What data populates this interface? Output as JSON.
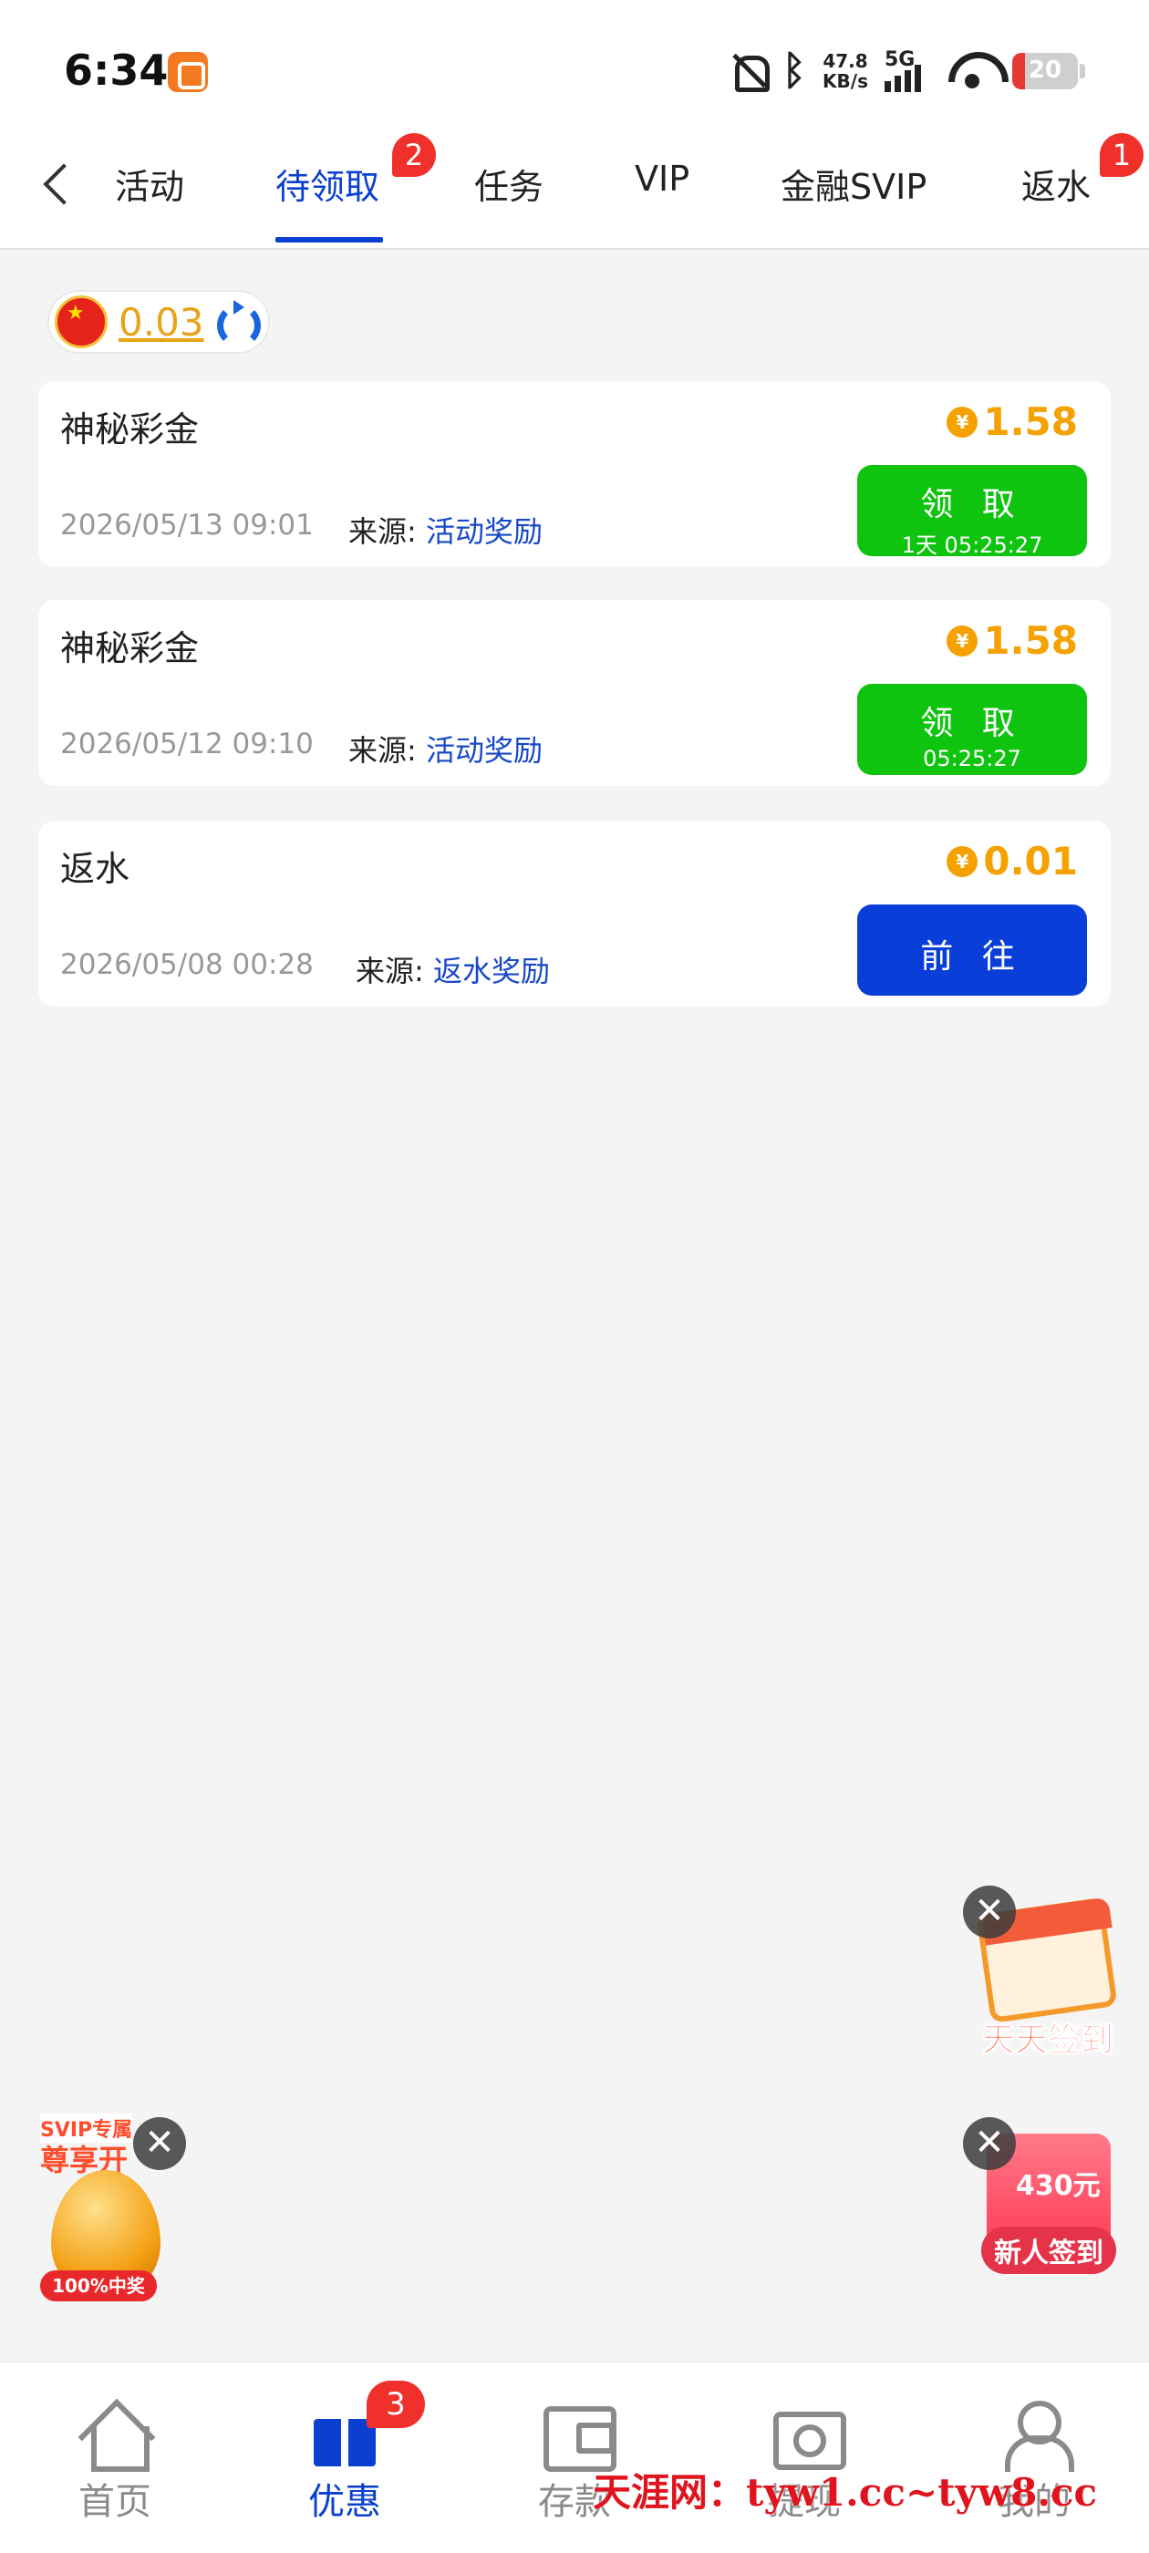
{
  "status_bar": {
    "time": "6:34",
    "net_speed_value": "47.8",
    "net_speed_unit": "KB/s",
    "network_type": "5G",
    "battery": "20",
    "battery_level": 0.2,
    "icons": [
      "app-notification-icon",
      "mute-bell-icon",
      "bluetooth-icon",
      "signal-icon",
      "wifi-icon",
      "battery-icon"
    ]
  },
  "tabs": {
    "items": [
      {
        "label": "活动"
      },
      {
        "label": "待领取",
        "badge": "2",
        "active": true
      },
      {
        "label": "任务"
      },
      {
        "label": "VIP"
      },
      {
        "label": "金融SVIP"
      },
      {
        "label": "返水",
        "badge": "1"
      }
    ],
    "accent_color": "#0a3fd0"
  },
  "balance": {
    "amount": "0.03",
    "flag_icon": "china-flag-icon",
    "refresh_icon": "refresh-icon"
  },
  "rewards": [
    {
      "title": "神秘彩金",
      "amount": "1.58",
      "date": "2026/05/13 09:01",
      "source_label": "来源:",
      "source": "活动奖励",
      "button_label": "领 取",
      "button_sub": "1天 05:25:27",
      "button_color": "#0fc40f"
    },
    {
      "title": "神秘彩金",
      "amount": "1.58",
      "date": "2026/05/12 09:10",
      "source_label": "来源:",
      "source": "活动奖励",
      "button_label": "领 取",
      "button_sub": "05:25:27",
      "button_color": "#0fc40f"
    },
    {
      "title": "返水",
      "amount": "0.01",
      "date": "2026/05/08 00:28",
      "source_label": "来源:",
      "source": "返水奖励",
      "button_label": "前 往",
      "button_color": "#0a3ed8"
    }
  ],
  "coin_symbol": "¥",
  "promos": {
    "daily_checkin": "天天签到",
    "new_user_checkin": "新人签到",
    "new_user_amount": "430元",
    "svip_tag": "SVIP专属",
    "svip_title": "尊享开",
    "svip_band": "100%中奖",
    "close_symbol": "✕"
  },
  "bottom_nav": {
    "items": [
      {
        "label": "首页",
        "icon": "home-icon"
      },
      {
        "label": "优惠",
        "icon": "gift-icon",
        "badge": "3",
        "active": true
      },
      {
        "label": "存款",
        "icon": "wallet-icon"
      },
      {
        "label": "提现",
        "icon": "cash-icon"
      },
      {
        "label": "我的",
        "icon": "user-icon"
      }
    ]
  },
  "watermark": "天涯网：tyw1.cc~tyw8.cc"
}
